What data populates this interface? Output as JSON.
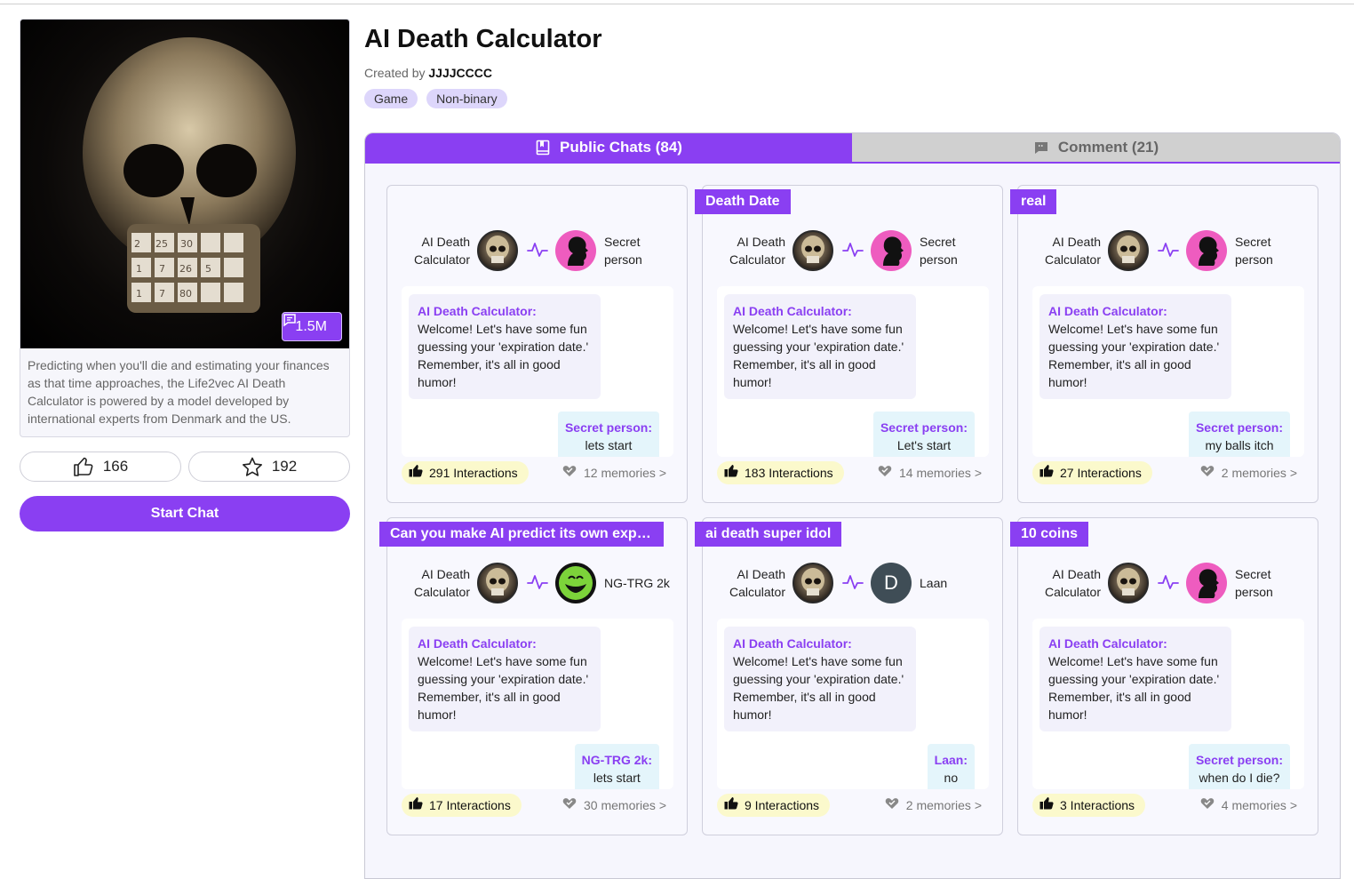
{
  "bot": {
    "title": "AI Death Calculator",
    "created_by_prefix": "Created by",
    "creator": "JJJJCCCC",
    "tags": [
      "Game",
      "Non-binary"
    ],
    "chat_count": "1.5M",
    "description": "Predicting when you'll die and estimating your finances as that time approaches, the Life2vec AI Death Calculator is powered by a model developed by international experts from Denmark and the US.",
    "likes": "166",
    "favorites": "192",
    "start_label": "Start Chat"
  },
  "tabs": {
    "public_chats": "Public Chats (84)",
    "comment": "Comment (21)"
  },
  "colors": {
    "accent": "#8a3ff2",
    "interactions_bg": "#fbf9cc",
    "user_bubble": "#e4f5fb"
  },
  "cards": [
    {
      "ribbon": "",
      "bot_name": "AI Death Calculator",
      "user_name": "Secret person",
      "user_avatar": "pink",
      "bot_label": "AI Death Calculator:",
      "bot_message": "Welcome! Let's have some fun guessing your 'expiration date.' Remember, it's all in good humor!",
      "user_label": "Secret person:",
      "user_message": "lets start",
      "interactions": "291 Interactions",
      "memories": "12 memories >"
    },
    {
      "ribbon": "Death Date",
      "bot_name": "AI Death Calculator",
      "user_name": "Secret person",
      "user_avatar": "pink",
      "bot_label": "AI Death Calculator:",
      "bot_message": "Welcome! Let's have some fun guessing your 'expiration date.' Remember, it's all in good humor!",
      "user_label": "Secret person:",
      "user_message": "Let's start",
      "interactions": "183 Interactions",
      "memories": "14 memories >"
    },
    {
      "ribbon": "real",
      "bot_name": "AI Death Calculator",
      "user_name": "Secret person",
      "user_avatar": "pink",
      "bot_label": "AI Death Calculator:",
      "bot_message": "Welcome! Let's have some fun guessing your 'expiration date.' Remember, it's all in good humor!",
      "user_label": "Secret person:",
      "user_message": "my balls itch",
      "interactions": "27 Interactions",
      "memories": "2 memories >"
    },
    {
      "ribbon": "Can you make AI predict its own expira...",
      "bot_name": "AI Death Calculator",
      "user_name": "NG-TRG 2k",
      "user_avatar": "green",
      "bot_label": "AI Death Calculator:",
      "bot_message": "Welcome! Let's have some fun guessing your 'expiration date.' Remember, it's all in good humor!",
      "user_label": "NG-TRG 2k:",
      "user_message": "lets start",
      "interactions": "17 Interactions",
      "memories": "30 memories >"
    },
    {
      "ribbon": "ai death super idol",
      "bot_name": "AI Death Calculator",
      "user_name": "Laan",
      "user_avatar": "D",
      "bot_label": "AI Death Calculator:",
      "bot_message": "Welcome! Let's have some fun guessing your 'expiration date.' Remember, it's all in good humor!",
      "user_label": "Laan:",
      "user_message": "no",
      "interactions": "9 Interactions",
      "memories": "2 memories >"
    },
    {
      "ribbon": "10 coins",
      "bot_name": "AI Death Calculator",
      "user_name": "Secret person",
      "user_avatar": "pink",
      "bot_label": "AI Death Calculator:",
      "bot_message": "Welcome! Let's have some fun guessing your 'expiration date.' Remember, it's all in good humor!",
      "user_label": "Secret person:",
      "user_message": "when do I die?",
      "interactions": "3 Interactions",
      "memories": "4 memories >"
    }
  ]
}
